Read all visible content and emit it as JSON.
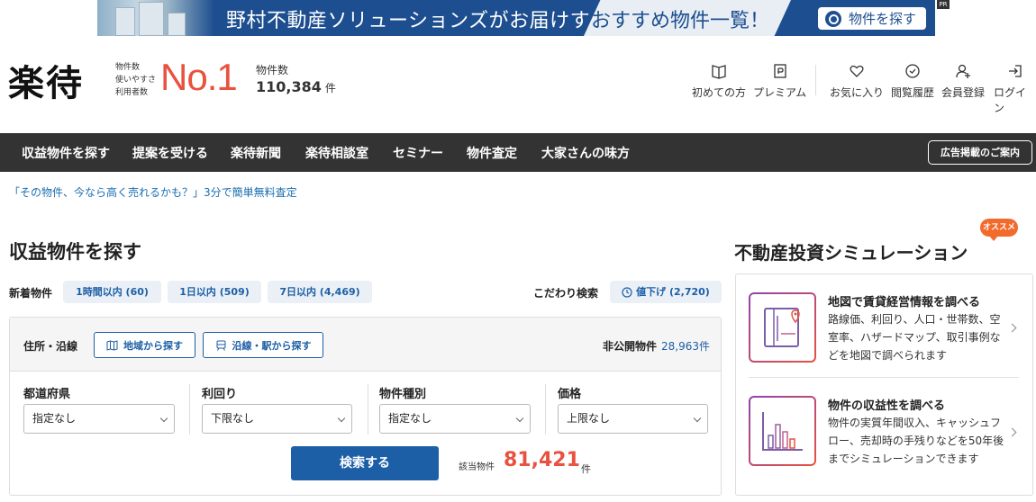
{
  "banner": {
    "text_main": "野村不動産ソリューションズがお届けする、",
    "text_highlight": "おすすめ物件一覧！",
    "search_button": "物件を探す",
    "pr": "PR"
  },
  "header": {
    "logo": "楽待",
    "rank_labels": [
      "物件数",
      "使いやすさ",
      "利用者数"
    ],
    "rank": "No.1",
    "property_count_label": "物件数",
    "property_count_value": "110,384",
    "property_count_unit": "件",
    "nav": [
      {
        "label": "初めての方",
        "icon": "book-icon"
      },
      {
        "label": "プレミアム",
        "icon": "premium-icon"
      },
      {
        "label": "お気に入り",
        "icon": "heart-icon"
      },
      {
        "label": "閲覧履歴",
        "icon": "history-icon"
      },
      {
        "label": "会員登録",
        "icon": "user-add-icon"
      },
      {
        "label": "ログイン",
        "icon": "login-icon"
      }
    ]
  },
  "navbar": {
    "items": [
      "収益物件を探す",
      "提案を受ける",
      "楽待新聞",
      "楽待相談室",
      "セミナー",
      "物件査定",
      "大家さんの味方"
    ],
    "ad_button": "広告掲載のご案内"
  },
  "promo": "「その物件、今なら高く売れるかも？」3分で簡単無料査定",
  "search": {
    "title": "収益物件を探す",
    "newest_label": "新着物件",
    "newest_chips": [
      "1時間以内 (60)",
      "1日以内 (509)",
      "7日以内 (4,469)"
    ],
    "kodawari_label": "こだわり検索",
    "kodawari_chip": "値下げ (2,720)",
    "area_label": "住所・沿線",
    "area_button": "地域から探す",
    "line_button": "沿線・駅から探す",
    "hikokai_label": "非公開物件",
    "hikokai_value": "28,963件",
    "fields": [
      {
        "label": "都道府県",
        "value": "指定なし"
      },
      {
        "label": "利回り",
        "value": "下限なし"
      },
      {
        "label": "物件種別",
        "value": "指定なし"
      },
      {
        "label": "価格",
        "value": "上限なし"
      }
    ],
    "submit": "検索する",
    "hit_label": "該当物件",
    "hit_value": "81,421",
    "hit_unit": "件"
  },
  "simulation": {
    "title": "不動産投資シミュレーション",
    "badge": "オススメ",
    "items": [
      {
        "title": "地図で賃貸経営情報を調べる",
        "desc": "路線価、利回り、人口・世帯数、空室率、ハザードマップ、取引事例などを地図で調べられます",
        "icon": "map-book-icon"
      },
      {
        "title": "物件の収益性を調べる",
        "desc": "物件の実質年間収入、キャッシュフロー、売却時の手残りなどを50年後までシミュレーションできます",
        "icon": "bar-chart-icon"
      }
    ]
  },
  "colors": {
    "brand_blue": "#1d5fa6",
    "accent_red": "#e8523f",
    "nav_bg": "#333333",
    "badge_orange": "#f26b2d"
  }
}
